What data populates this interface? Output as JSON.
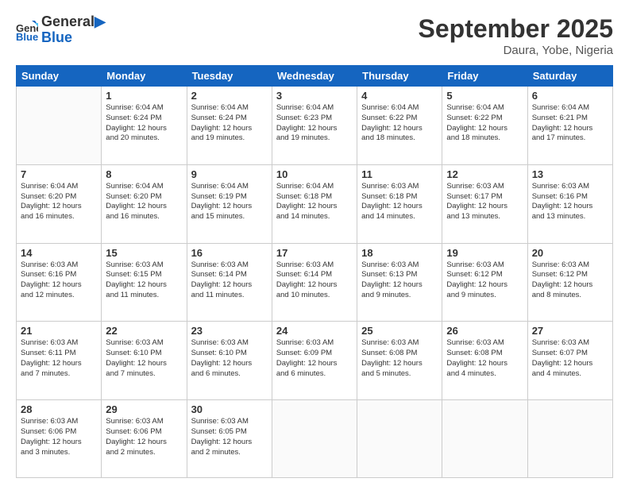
{
  "header": {
    "logo_line1": "General",
    "logo_line2": "Blue",
    "month": "September 2025",
    "location": "Daura, Yobe, Nigeria"
  },
  "columns": [
    "Sunday",
    "Monday",
    "Tuesday",
    "Wednesday",
    "Thursday",
    "Friday",
    "Saturday"
  ],
  "weeks": [
    [
      {
        "day": "",
        "info": ""
      },
      {
        "day": "1",
        "info": "Sunrise: 6:04 AM\nSunset: 6:24 PM\nDaylight: 12 hours\nand 20 minutes."
      },
      {
        "day": "2",
        "info": "Sunrise: 6:04 AM\nSunset: 6:24 PM\nDaylight: 12 hours\nand 19 minutes."
      },
      {
        "day": "3",
        "info": "Sunrise: 6:04 AM\nSunset: 6:23 PM\nDaylight: 12 hours\nand 19 minutes."
      },
      {
        "day": "4",
        "info": "Sunrise: 6:04 AM\nSunset: 6:22 PM\nDaylight: 12 hours\nand 18 minutes."
      },
      {
        "day": "5",
        "info": "Sunrise: 6:04 AM\nSunset: 6:22 PM\nDaylight: 12 hours\nand 18 minutes."
      },
      {
        "day": "6",
        "info": "Sunrise: 6:04 AM\nSunset: 6:21 PM\nDaylight: 12 hours\nand 17 minutes."
      }
    ],
    [
      {
        "day": "7",
        "info": "Sunrise: 6:04 AM\nSunset: 6:20 PM\nDaylight: 12 hours\nand 16 minutes."
      },
      {
        "day": "8",
        "info": "Sunrise: 6:04 AM\nSunset: 6:20 PM\nDaylight: 12 hours\nand 16 minutes."
      },
      {
        "day": "9",
        "info": "Sunrise: 6:04 AM\nSunset: 6:19 PM\nDaylight: 12 hours\nand 15 minutes."
      },
      {
        "day": "10",
        "info": "Sunrise: 6:04 AM\nSunset: 6:18 PM\nDaylight: 12 hours\nand 14 minutes."
      },
      {
        "day": "11",
        "info": "Sunrise: 6:03 AM\nSunset: 6:18 PM\nDaylight: 12 hours\nand 14 minutes."
      },
      {
        "day": "12",
        "info": "Sunrise: 6:03 AM\nSunset: 6:17 PM\nDaylight: 12 hours\nand 13 minutes."
      },
      {
        "day": "13",
        "info": "Sunrise: 6:03 AM\nSunset: 6:16 PM\nDaylight: 12 hours\nand 13 minutes."
      }
    ],
    [
      {
        "day": "14",
        "info": "Sunrise: 6:03 AM\nSunset: 6:16 PM\nDaylight: 12 hours\nand 12 minutes."
      },
      {
        "day": "15",
        "info": "Sunrise: 6:03 AM\nSunset: 6:15 PM\nDaylight: 12 hours\nand 11 minutes."
      },
      {
        "day": "16",
        "info": "Sunrise: 6:03 AM\nSunset: 6:14 PM\nDaylight: 12 hours\nand 11 minutes."
      },
      {
        "day": "17",
        "info": "Sunrise: 6:03 AM\nSunset: 6:14 PM\nDaylight: 12 hours\nand 10 minutes."
      },
      {
        "day": "18",
        "info": "Sunrise: 6:03 AM\nSunset: 6:13 PM\nDaylight: 12 hours\nand 9 minutes."
      },
      {
        "day": "19",
        "info": "Sunrise: 6:03 AM\nSunset: 6:12 PM\nDaylight: 12 hours\nand 9 minutes."
      },
      {
        "day": "20",
        "info": "Sunrise: 6:03 AM\nSunset: 6:12 PM\nDaylight: 12 hours\nand 8 minutes."
      }
    ],
    [
      {
        "day": "21",
        "info": "Sunrise: 6:03 AM\nSunset: 6:11 PM\nDaylight: 12 hours\nand 7 minutes."
      },
      {
        "day": "22",
        "info": "Sunrise: 6:03 AM\nSunset: 6:10 PM\nDaylight: 12 hours\nand 7 minutes."
      },
      {
        "day": "23",
        "info": "Sunrise: 6:03 AM\nSunset: 6:10 PM\nDaylight: 12 hours\nand 6 minutes."
      },
      {
        "day": "24",
        "info": "Sunrise: 6:03 AM\nSunset: 6:09 PM\nDaylight: 12 hours\nand 6 minutes."
      },
      {
        "day": "25",
        "info": "Sunrise: 6:03 AM\nSunset: 6:08 PM\nDaylight: 12 hours\nand 5 minutes."
      },
      {
        "day": "26",
        "info": "Sunrise: 6:03 AM\nSunset: 6:08 PM\nDaylight: 12 hours\nand 4 minutes."
      },
      {
        "day": "27",
        "info": "Sunrise: 6:03 AM\nSunset: 6:07 PM\nDaylight: 12 hours\nand 4 minutes."
      }
    ],
    [
      {
        "day": "28",
        "info": "Sunrise: 6:03 AM\nSunset: 6:06 PM\nDaylight: 12 hours\nand 3 minutes."
      },
      {
        "day": "29",
        "info": "Sunrise: 6:03 AM\nSunset: 6:06 PM\nDaylight: 12 hours\nand 2 minutes."
      },
      {
        "day": "30",
        "info": "Sunrise: 6:03 AM\nSunset: 6:05 PM\nDaylight: 12 hours\nand 2 minutes."
      },
      {
        "day": "",
        "info": ""
      },
      {
        "day": "",
        "info": ""
      },
      {
        "day": "",
        "info": ""
      },
      {
        "day": "",
        "info": ""
      }
    ]
  ]
}
